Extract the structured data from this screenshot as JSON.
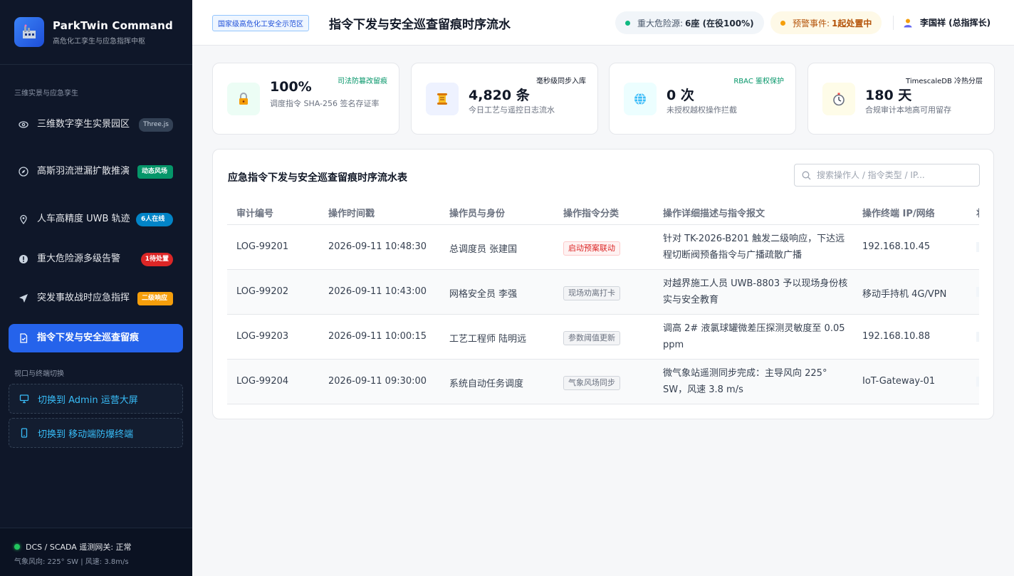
{
  "brand": {
    "title": "ParkTwin Command",
    "subtitle": "高危化工孪生与应急指挥中枢"
  },
  "sidebar": {
    "section1": "三维实景与应急孪生",
    "items": [
      {
        "label": "三维数字孪生实景园区",
        "badge": "Three.js",
        "icon": "eye-icon"
      },
      {
        "label": "高斯羽流泄漏扩散推演",
        "badge": "动态风场",
        "icon": "compass-icon"
      },
      {
        "label": "人车高精度 UWB 轨迹",
        "badge": "6人在线",
        "icon": "location-pin-icon"
      },
      {
        "label": "重大危险源多级告警",
        "badge": "1待处置",
        "icon": "alert-icon"
      },
      {
        "label": "突发事故战时应急指挥",
        "badge": "二级响应",
        "icon": "send-icon"
      },
      {
        "label": "指令下发与安全巡查留痕",
        "icon": "document-check-icon"
      }
    ],
    "section2": "视口与终端切换",
    "switches": [
      {
        "label": "切换到 Admin 运营大屏",
        "icon": "monitor-icon"
      },
      {
        "label": "切换到 移动端防爆终端",
        "icon": "mobile-icon"
      }
    ],
    "footer": {
      "status": "DCS / SCADA 遥测网关: 正常",
      "weather": "气象风向: 225° SW | 风速: 3.8m/s"
    }
  },
  "header": {
    "zone_tag": "国家级高危化工安全示范区",
    "title": "指令下发与安全巡查留痕时序流水",
    "hazard_label": "重大危险源:",
    "hazard_value": "6座 (在役100%)",
    "warn_label": "预警事件:",
    "warn_value": "1起处置中",
    "user": "李国祥 (总指挥长)"
  },
  "cards": [
    {
      "value": "100%",
      "label": "调度指令 SHA-256 签名存证率",
      "tag": "司法防篡改留痕",
      "icon": "lock-icon",
      "tag_color": "#059669"
    },
    {
      "value": "4,820 条",
      "label": "今日工艺与遥控日志流水",
      "tag": "毫秒级同步入库",
      "icon": "scroll-icon",
      "tag_color": "#111827"
    },
    {
      "value": "0 次",
      "label": "未授权越权操作拦截",
      "tag": "RBAC 鉴权保护",
      "icon": "globe-icon",
      "tag_color": "#059669"
    },
    {
      "value": "180 天",
      "label": "合规审计本地高可用留存",
      "tag": "TimescaleDB 冷热分层",
      "icon": "stopwatch-icon",
      "tag_color": "#111827"
    }
  ],
  "table": {
    "title": "应急指令下发与安全巡查留痕时序流水表",
    "search_placeholder": "搜索操作人 / 指令类型 / IP...",
    "columns": [
      "审计编号",
      "操作时间戳",
      "操作员与身份",
      "操作指令分类",
      "操作详细描述与指令报文",
      "操作终端 IP/网络",
      "状"
    ],
    "rows": [
      {
        "id": "LOG-99201",
        "time": "2026-09-11 10:48:30",
        "operator": "总调度员 张建国",
        "category": "启动预案联动",
        "cat_style": "red",
        "desc": "针对 TK-2026-B201 触发二级响应，下达远程切断阀预备指令与广播疏散广播",
        "ip": "192.168.10.45"
      },
      {
        "id": "LOG-99202",
        "time": "2026-09-11 10:43:00",
        "operator": "网格安全员 李强",
        "category": "现场劝离打卡",
        "cat_style": "gray",
        "desc": "对越界施工人员 UWB-8803 予以现场身份核实与安全教育",
        "ip": "移动手持机 4G/VPN"
      },
      {
        "id": "LOG-99203",
        "time": "2026-09-11 10:00:15",
        "operator": "工艺工程师 陆明远",
        "category": "参数阈值更新",
        "cat_style": "gray",
        "desc": "调高 2# 液氯球罐微差压探测灵敏度至 0.05 ppm",
        "ip": "192.168.10.88"
      },
      {
        "id": "LOG-99204",
        "time": "2026-09-11 09:30:00",
        "operator": "系统自动任务调度",
        "category": "气象风场同步",
        "cat_style": "gray",
        "desc": "微气象站遥测同步完成：主导风向 225° SW，风速 3.8 m/s",
        "ip": "IoT-Gateway-01"
      }
    ]
  }
}
